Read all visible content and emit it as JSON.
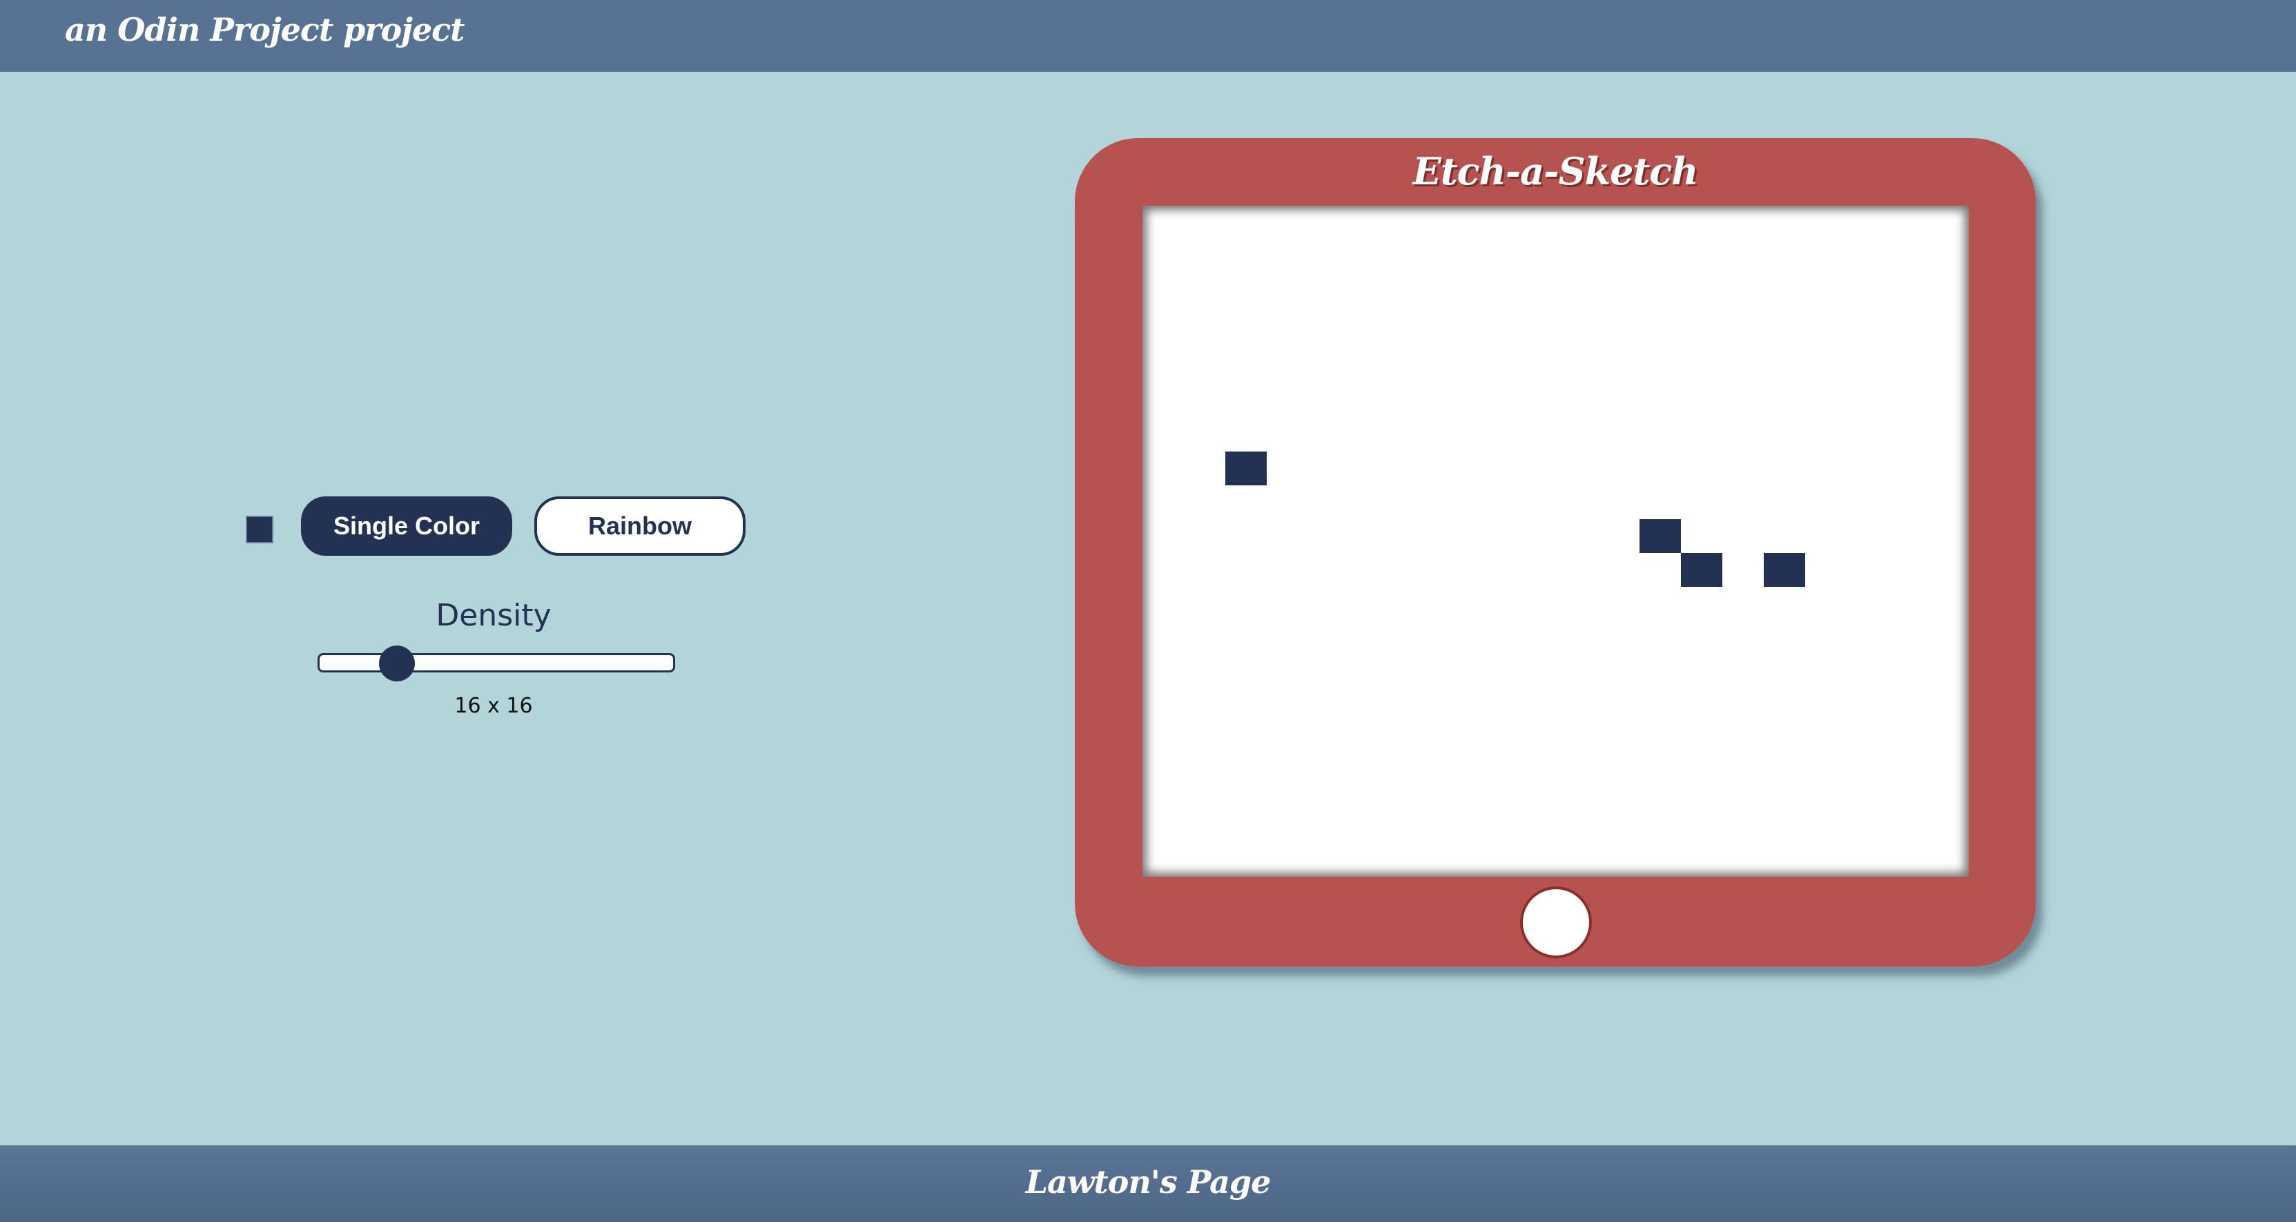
{
  "header": {
    "brand": "an Odin Project project"
  },
  "controls": {
    "color_swatch": "#233252",
    "single_color_label": "Single Color",
    "rainbow_label": "Rainbow",
    "density_label": "Density",
    "density_value_text": "16 x 16",
    "density_value": 16,
    "active_mode": "Single Color"
  },
  "sketch": {
    "title": "Etch-a-Sketch",
    "grid_size": 16,
    "filled_cells": [
      {
        "row": 7,
        "col": 3
      },
      {
        "row": 9,
        "col": 13
      },
      {
        "row": 10,
        "col": 14
      },
      {
        "row": 10,
        "col": 16
      }
    ],
    "fill_color": "#233252"
  },
  "footer": {
    "link": "Lawton's Page"
  },
  "colors": {
    "header_bg": "#577293",
    "page_bg": "#b3d4d9",
    "frame": "#b65350",
    "accent": "#233252"
  }
}
